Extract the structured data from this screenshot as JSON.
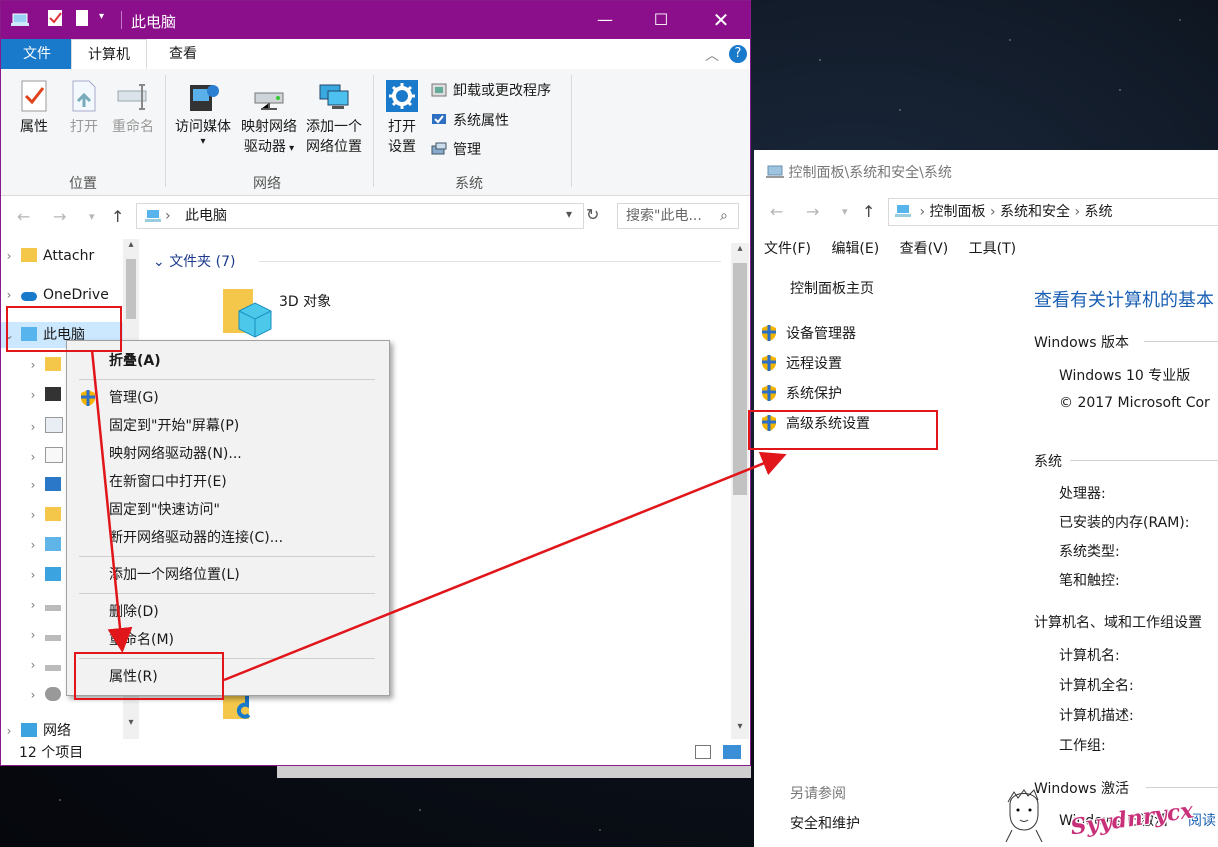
{
  "explorer": {
    "title": "此电脑",
    "tabs": {
      "file": "文件",
      "computer": "计算机",
      "view": "查看"
    },
    "ribbon": {
      "location": {
        "group": "位置",
        "properties": "属性",
        "open": "打开",
        "rename": "重命名"
      },
      "network": {
        "group": "网络",
        "media": "访问媒体",
        "map_drive_1": "映射网络",
        "map_drive_2": "驱动器",
        "add_loc_1": "添加一个",
        "add_loc_2": "网络位置"
      },
      "system": {
        "group": "系统",
        "open_settings_1": "打开",
        "open_settings_2": "设置",
        "uninstall": "卸载或更改程序",
        "sys_props": "系统属性",
        "manage": "管理"
      }
    },
    "address": "此电脑",
    "search_placeholder": "搜索\"此电...",
    "nav": {
      "attach": "Attachr",
      "onedrive": "OneDrive",
      "this_pc": "此电脑",
      "network": "网络"
    },
    "folders_header": "文件夹 (7)",
    "folder_3d": "3D 对象",
    "status": "12 个项目"
  },
  "context_menu": {
    "collapse": "折叠(A)",
    "manage": "管理(G)",
    "pin_start": "固定到\"开始\"屏幕(P)",
    "map_drive": "映射网络驱动器(N)...",
    "open_new": "在新窗口中打开(E)",
    "pin_quick": "固定到\"快速访问\"",
    "disconnect": "断开网络驱动器的连接(C)...",
    "add_network": "添加一个网络位置(L)",
    "delete": "删除(D)",
    "rename": "重命名(M)",
    "properties": "属性(R)"
  },
  "control_panel": {
    "title": "控制面板\\系统和安全\\系统",
    "breadcrumb": [
      "控制面板",
      "系统和安全",
      "系统"
    ],
    "menu": [
      "文件(F)",
      "编辑(E)",
      "查看(V)",
      "工具(T)"
    ],
    "home": "控制面板主页",
    "links": [
      "设备管理器",
      "远程设置",
      "系统保护",
      "高级系统设置"
    ],
    "heading": "查看有关计算机的基本",
    "windows_edition": "Windows 版本",
    "edition": "Windows 10 专业版",
    "copyright": "© 2017 Microsoft Cor",
    "system": "系统",
    "processor": "处理器:",
    "ram": "已安装的内存(RAM):",
    "sys_type": "系统类型:",
    "pen_touch": "笔和触控:",
    "computer_name_section": "计算机名、域和工作组设置",
    "computer_name": "计算机名:",
    "full_name": "计算机全名:",
    "description": "计算机描述:",
    "workgroup": "工作组:",
    "activation": "Windows 激活",
    "activated": "Windows 已激活",
    "read": "阅读",
    "see_also": "另请参阅",
    "security": "安全和维护"
  },
  "watermark": "Syydnrycx",
  "colors": {
    "titlebar": "#8b0f8b",
    "file_tab": "#1979ca",
    "annotation": "#e0161b",
    "link_blue": "#1a5fb4"
  }
}
